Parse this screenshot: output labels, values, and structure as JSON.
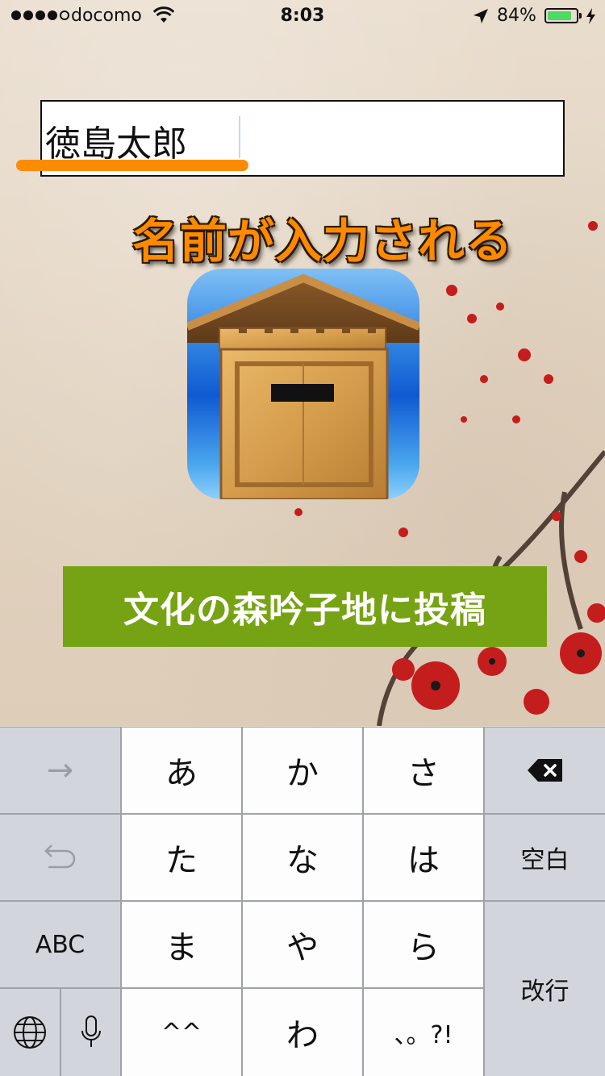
{
  "status_bar": {
    "carrier": "docomo",
    "time": "8:03",
    "battery_percent": "84%",
    "battery_level": 0.84,
    "signal_bars": 4,
    "signal_total": 5
  },
  "name_field": {
    "value": "徳島太郎"
  },
  "caption": "名前が入力される",
  "submit_button": {
    "label": "文化の森吟子地に投稿"
  },
  "keyboard": {
    "row1": {
      "left": "→",
      "k1": "あ",
      "k2": "か",
      "k3": "さ"
    },
    "row2": {
      "k1": "た",
      "k2": "な",
      "k3": "は",
      "right": "空白"
    },
    "row3": {
      "left": "ABC",
      "k1": "ま",
      "k2": "や",
      "k3": "ら"
    },
    "row4": {
      "k1": "^^",
      "k2": "わ",
      "k3": "、。?!"
    },
    "return_key": "改行"
  },
  "colors": {
    "accent_orange": "#ff8a00",
    "submit_green": "#76a313",
    "battery_green": "#4cd964"
  }
}
